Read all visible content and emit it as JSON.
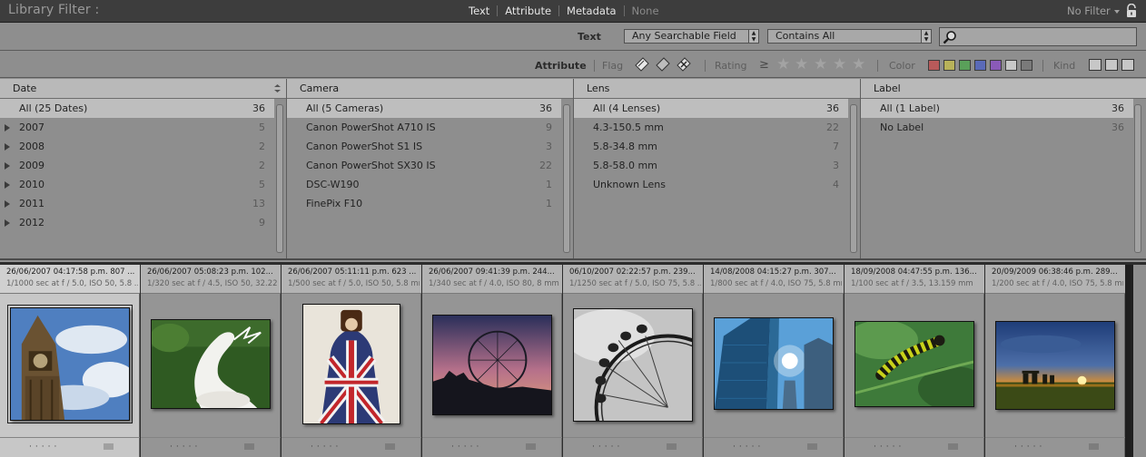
{
  "topbar": {
    "title": "Library Filter :",
    "tabs": [
      {
        "label": "Text",
        "active": true
      },
      {
        "label": "Attribute",
        "active": true
      },
      {
        "label": "Metadata",
        "active": true
      },
      {
        "label": "None",
        "active": false
      }
    ],
    "preset": "No Filter",
    "lock_icon": "lock-icon"
  },
  "text_filter": {
    "label": "Text",
    "field": "Any Searchable Field",
    "rule": "Contains All",
    "search_value": "",
    "search_icon": "magnifier-icon"
  },
  "attribute_filter": {
    "label": "Attribute",
    "flag_label": "Flag",
    "rating_label": "Rating",
    "rating_operator": "≥",
    "rating_stars": 5,
    "color_label": "Color",
    "colors": [
      "#b85a5a",
      "#b8b25a",
      "#5aa05a",
      "#5a6ab8",
      "#8a5ab8",
      "#c8c8c8",
      "#7a7a7a"
    ],
    "kind_label": "Kind"
  },
  "metadata_browser": {
    "columns": [
      {
        "header": "Date",
        "rows": [
          {
            "label": "All (25 Dates)",
            "count": "36",
            "selected": true
          },
          {
            "label": "2007",
            "count": "5",
            "expandable": true
          },
          {
            "label": "2008",
            "count": "2",
            "expandable": true
          },
          {
            "label": "2009",
            "count": "2",
            "expandable": true
          },
          {
            "label": "2010",
            "count": "5",
            "expandable": true
          },
          {
            "label": "2011",
            "count": "13",
            "expandable": true
          },
          {
            "label": "2012",
            "count": "9",
            "expandable": true
          }
        ]
      },
      {
        "header": "Camera",
        "rows": [
          {
            "label": "All (5 Cameras)",
            "count": "36",
            "selected": true
          },
          {
            "label": "Canon PowerShot A710 IS",
            "count": "9"
          },
          {
            "label": "Canon PowerShot S1 IS",
            "count": "3"
          },
          {
            "label": "Canon PowerShot SX30 IS",
            "count": "22"
          },
          {
            "label": "DSC-W190",
            "count": "1"
          },
          {
            "label": "FinePix F10",
            "count": "1"
          }
        ]
      },
      {
        "header": "Lens",
        "rows": [
          {
            "label": "All (4 Lenses)",
            "count": "36",
            "selected": true
          },
          {
            "label": "4.3-150.5 mm",
            "count": "22"
          },
          {
            "label": "5.8-34.8 mm",
            "count": "7"
          },
          {
            "label": "5.8-58.0 mm",
            "count": "3"
          },
          {
            "label": "Unknown Lens",
            "count": "4"
          }
        ]
      },
      {
        "header": "Label",
        "rows": [
          {
            "label": "All (1 Label)",
            "count": "36",
            "selected": true
          },
          {
            "label": "No Label",
            "count": "36"
          }
        ]
      }
    ]
  },
  "photos": [
    {
      "line1": "26/06/2007 04:17:58 p.m.     807 ...",
      "line2": "1/1000 sec at f / 5.0, ISO 50, 5.8 ...",
      "subject": "clock-tower",
      "selected": true
    },
    {
      "line1": "26/06/2007 05:08:23 p.m.     102...",
      "line2": "1/320 sec at f / 4.5, ISO 50, 32.22 ...",
      "subject": "pelican"
    },
    {
      "line1": "26/06/2007 05:11:11 p.m.     623 ...",
      "line2": "1/500 sec at f / 5.0, ISO 50, 5.8 mm",
      "subject": "union-jack"
    },
    {
      "line1": "26/06/2007 09:41:39 p.m.     244...",
      "line2": "1/340 sec at f / 4.0, ISO 80, 8 mm",
      "subject": "ferris-wheel-sunset"
    },
    {
      "line1": "06/10/2007 02:22:57 p.m.     239...",
      "line2": "1/1250 sec at f / 5.0, ISO 75, 5.8 ...",
      "subject": "ferris-wheel-bw"
    },
    {
      "line1": "14/08/2008 04:15:27 p.m.     307...",
      "line2": "1/800 sec at f / 4.0, ISO 75, 5.8 mm",
      "subject": "skyscraper"
    },
    {
      "line1": "18/09/2008 04:47:55 p.m.     136...",
      "line2": "1/100 sec at f / 3.5, 13.159 mm",
      "subject": "caterpillar"
    },
    {
      "line1": "20/09/2009 06:38:46 p.m.     289...",
      "line2": "1/200 sec at f / 4.0, ISO 75, 5.8 mm",
      "subject": "stonehenge-sunset"
    }
  ]
}
